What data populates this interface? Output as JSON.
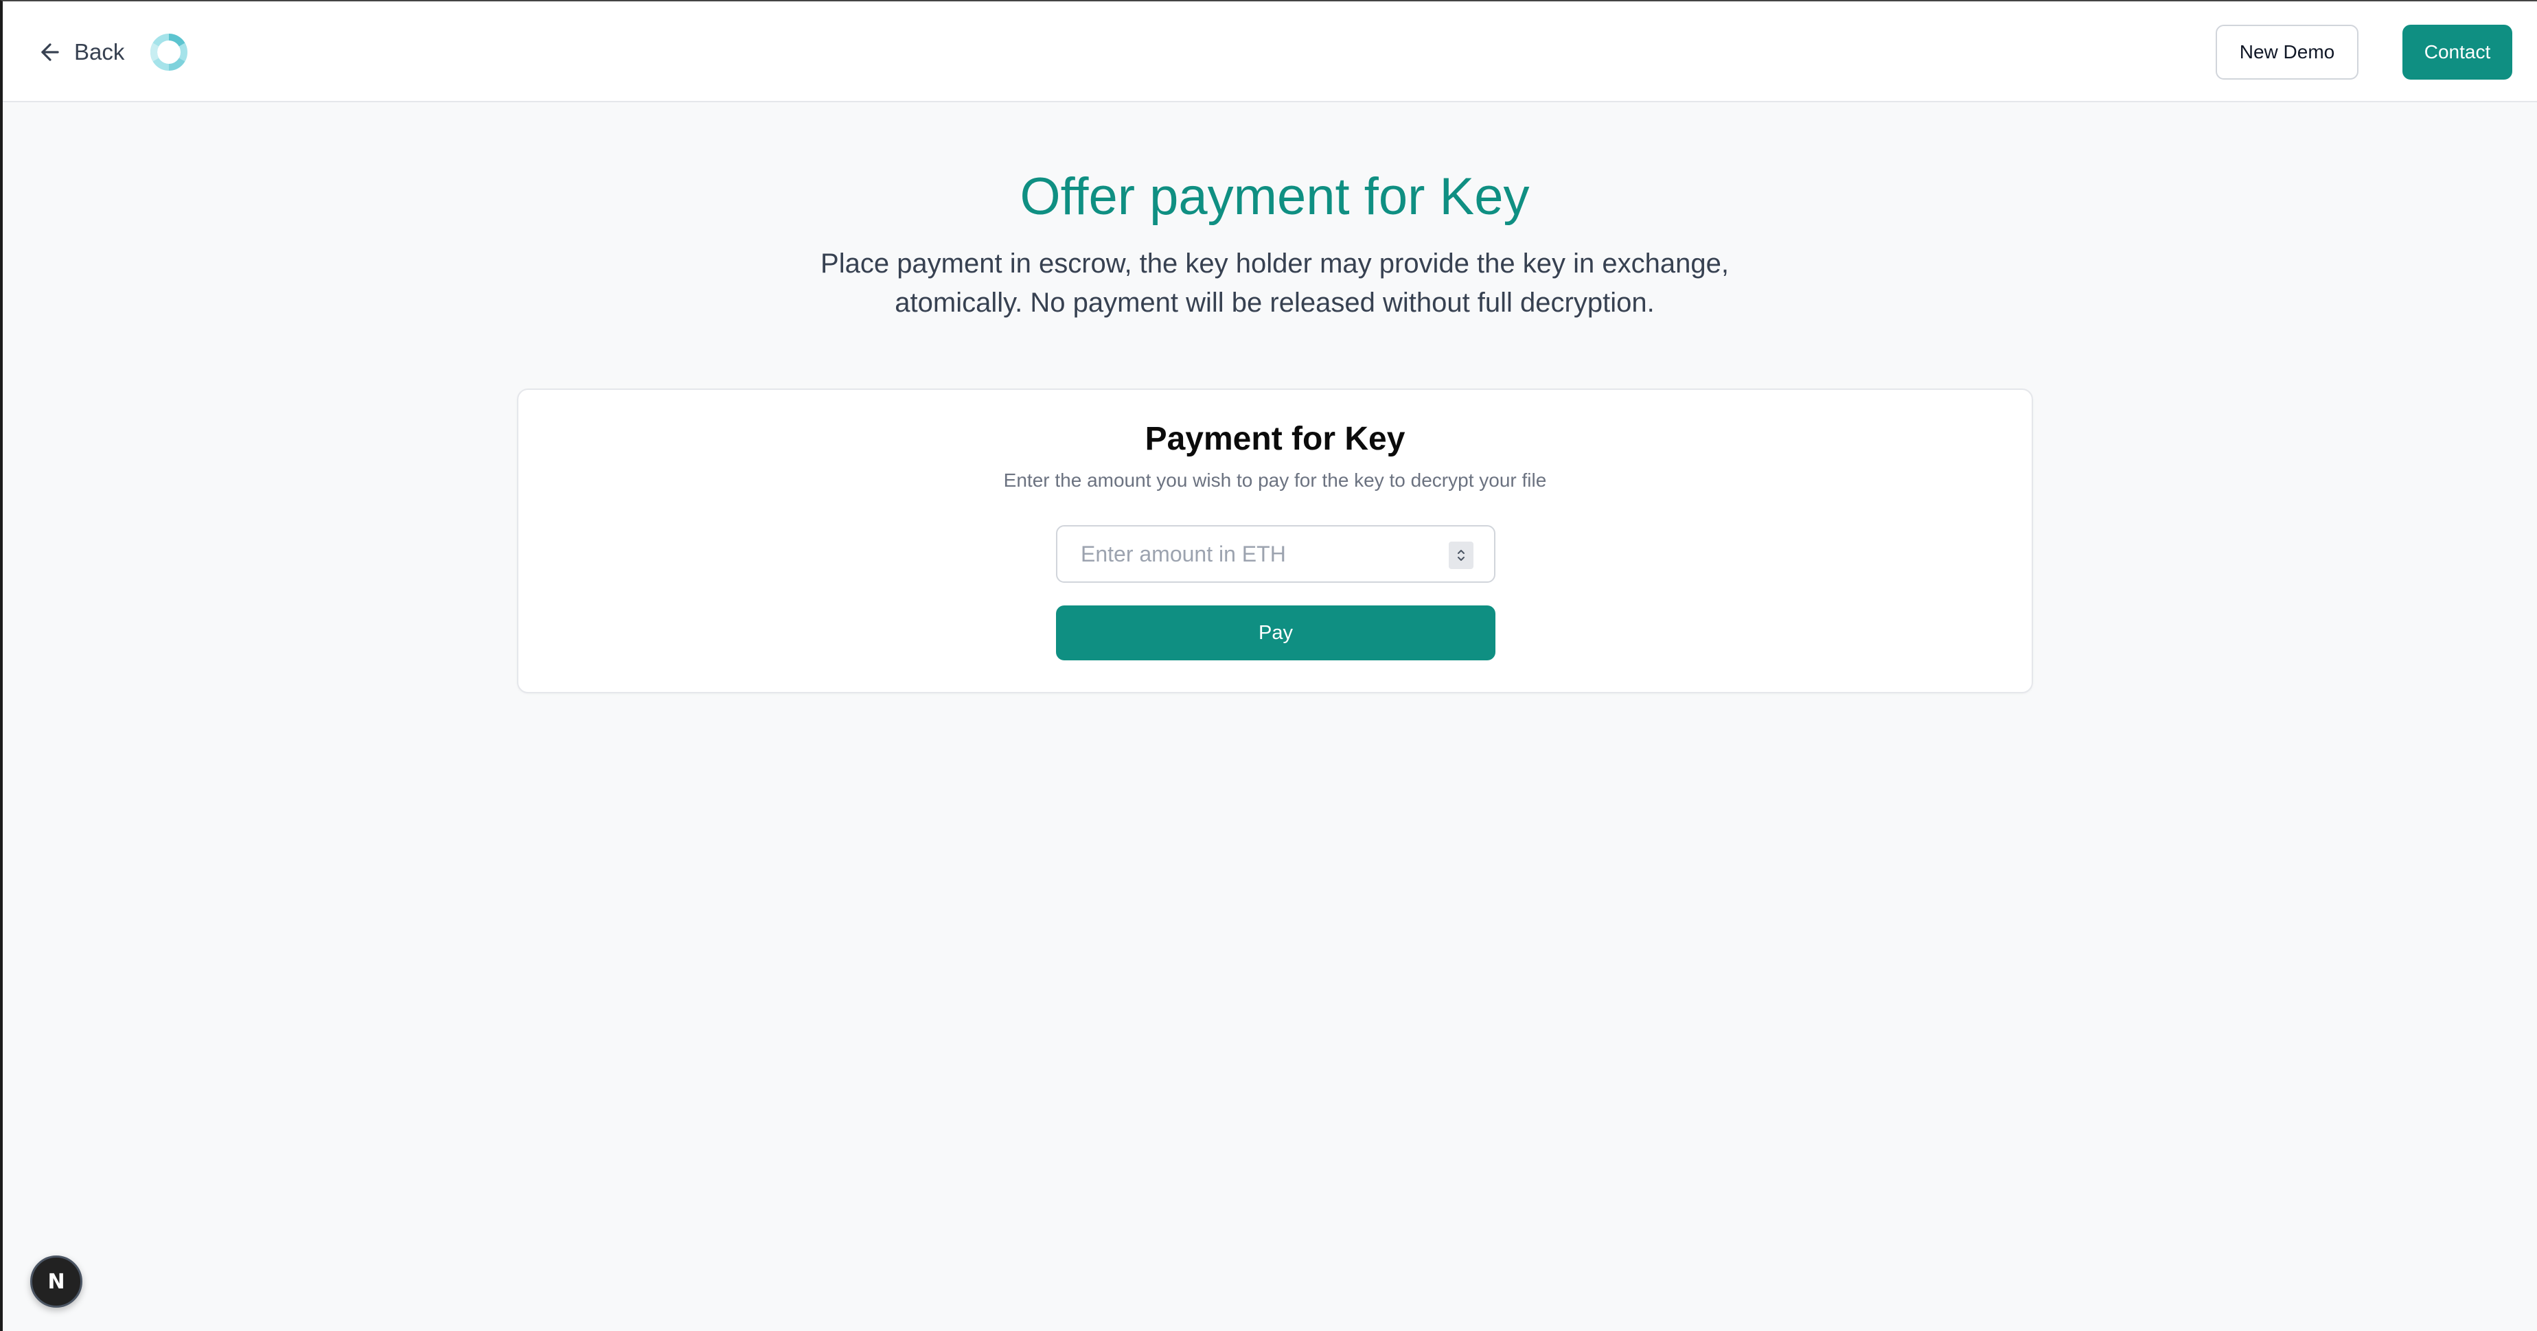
{
  "header": {
    "back_label": "Back",
    "new_demo_label": "New Demo",
    "contact_label": "Contact",
    "logo_icon": "spinning-logo-icon"
  },
  "hero": {
    "title": "Offer payment for Key",
    "description": "Place payment in escrow, the key holder may provide the key in exchange, atomically. No payment will be released without full decryption."
  },
  "card": {
    "title": "Payment for Key",
    "subtitle": "Enter the amount you wish to pay for the key to decrypt your file",
    "amount_placeholder": "Enter amount in ETH",
    "amount_value": "",
    "pay_label": "Pay"
  },
  "dev_badge": {
    "letter": "N"
  },
  "colors": {
    "accent": "#0f8f82",
    "title": "#0f8f82",
    "text": "#374151",
    "muted": "#6b7280",
    "background": "#f8f9fa"
  }
}
